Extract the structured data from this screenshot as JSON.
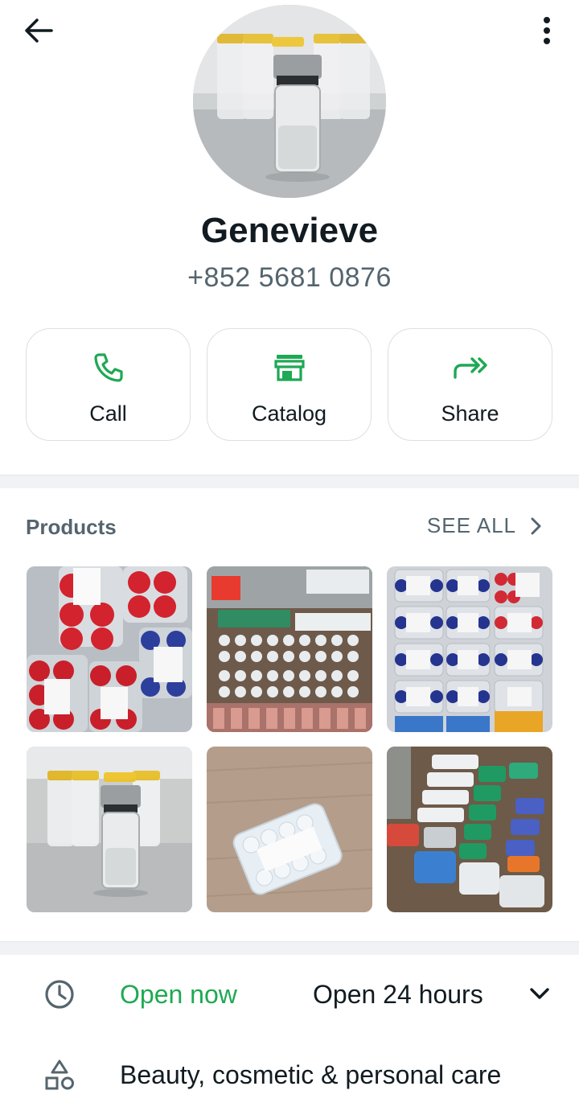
{
  "profile": {
    "name": "Genevieve",
    "phone": "+852 5681 0876",
    "avatar_icon": "vial-photo"
  },
  "actions": [
    {
      "label": "Call",
      "icon": "phone-icon"
    },
    {
      "label": "Catalog",
      "icon": "store-icon"
    },
    {
      "label": "Share",
      "icon": "share-arrow-icon"
    }
  ],
  "products": {
    "title": "Products",
    "see_all_label": "SEE ALL",
    "items": [
      {
        "icon": "vials-red-blue-photo"
      },
      {
        "icon": "vial-trays-photo"
      },
      {
        "icon": "vial-boxes-blue-photo"
      },
      {
        "icon": "single-vial-photo"
      },
      {
        "icon": "clear-vial-box-photo"
      },
      {
        "icon": "labeled-vial-boxes-photo"
      }
    ]
  },
  "business_info": {
    "status": "Open now",
    "hours": "Open 24 hours",
    "category": "Beauty, cosmetic & personal care"
  },
  "colors": {
    "accent": "#1fa855",
    "text": "#111b21",
    "muted": "#54656f"
  }
}
